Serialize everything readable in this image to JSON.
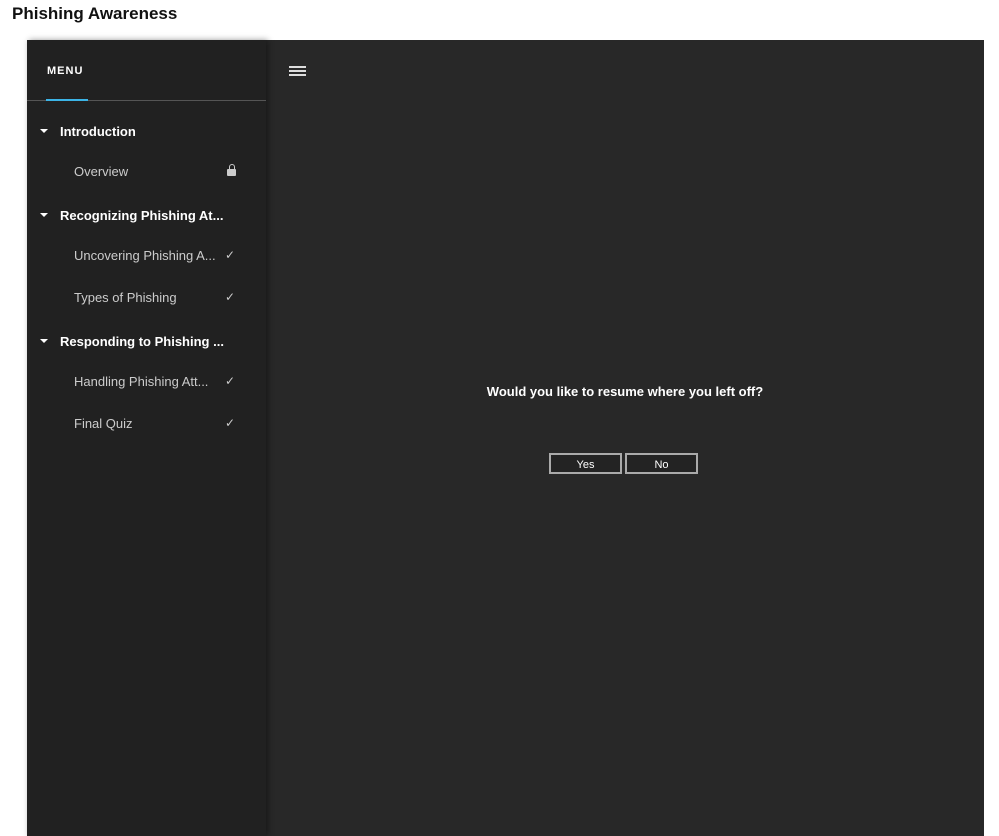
{
  "page_title": "Phishing Awareness",
  "menu": {
    "label": "MENU",
    "accent": "#3cb4e6"
  },
  "sections": [
    {
      "label": "Introduction",
      "items": [
        {
          "label": "Overview",
          "status": "locked"
        }
      ]
    },
    {
      "label": "Recognizing Phishing At...",
      "items": [
        {
          "label": "Uncovering Phishing A...",
          "status": "complete"
        },
        {
          "label": "Types of Phishing",
          "status": "complete"
        }
      ]
    },
    {
      "label": "Responding to Phishing ...",
      "items": [
        {
          "label": "Handling Phishing Att...",
          "status": "complete"
        },
        {
          "label": "Final Quiz",
          "status": "complete"
        }
      ]
    }
  ],
  "dialog": {
    "prompt": "Would you like to resume where you left off?",
    "yes": "Yes",
    "no": "No"
  }
}
